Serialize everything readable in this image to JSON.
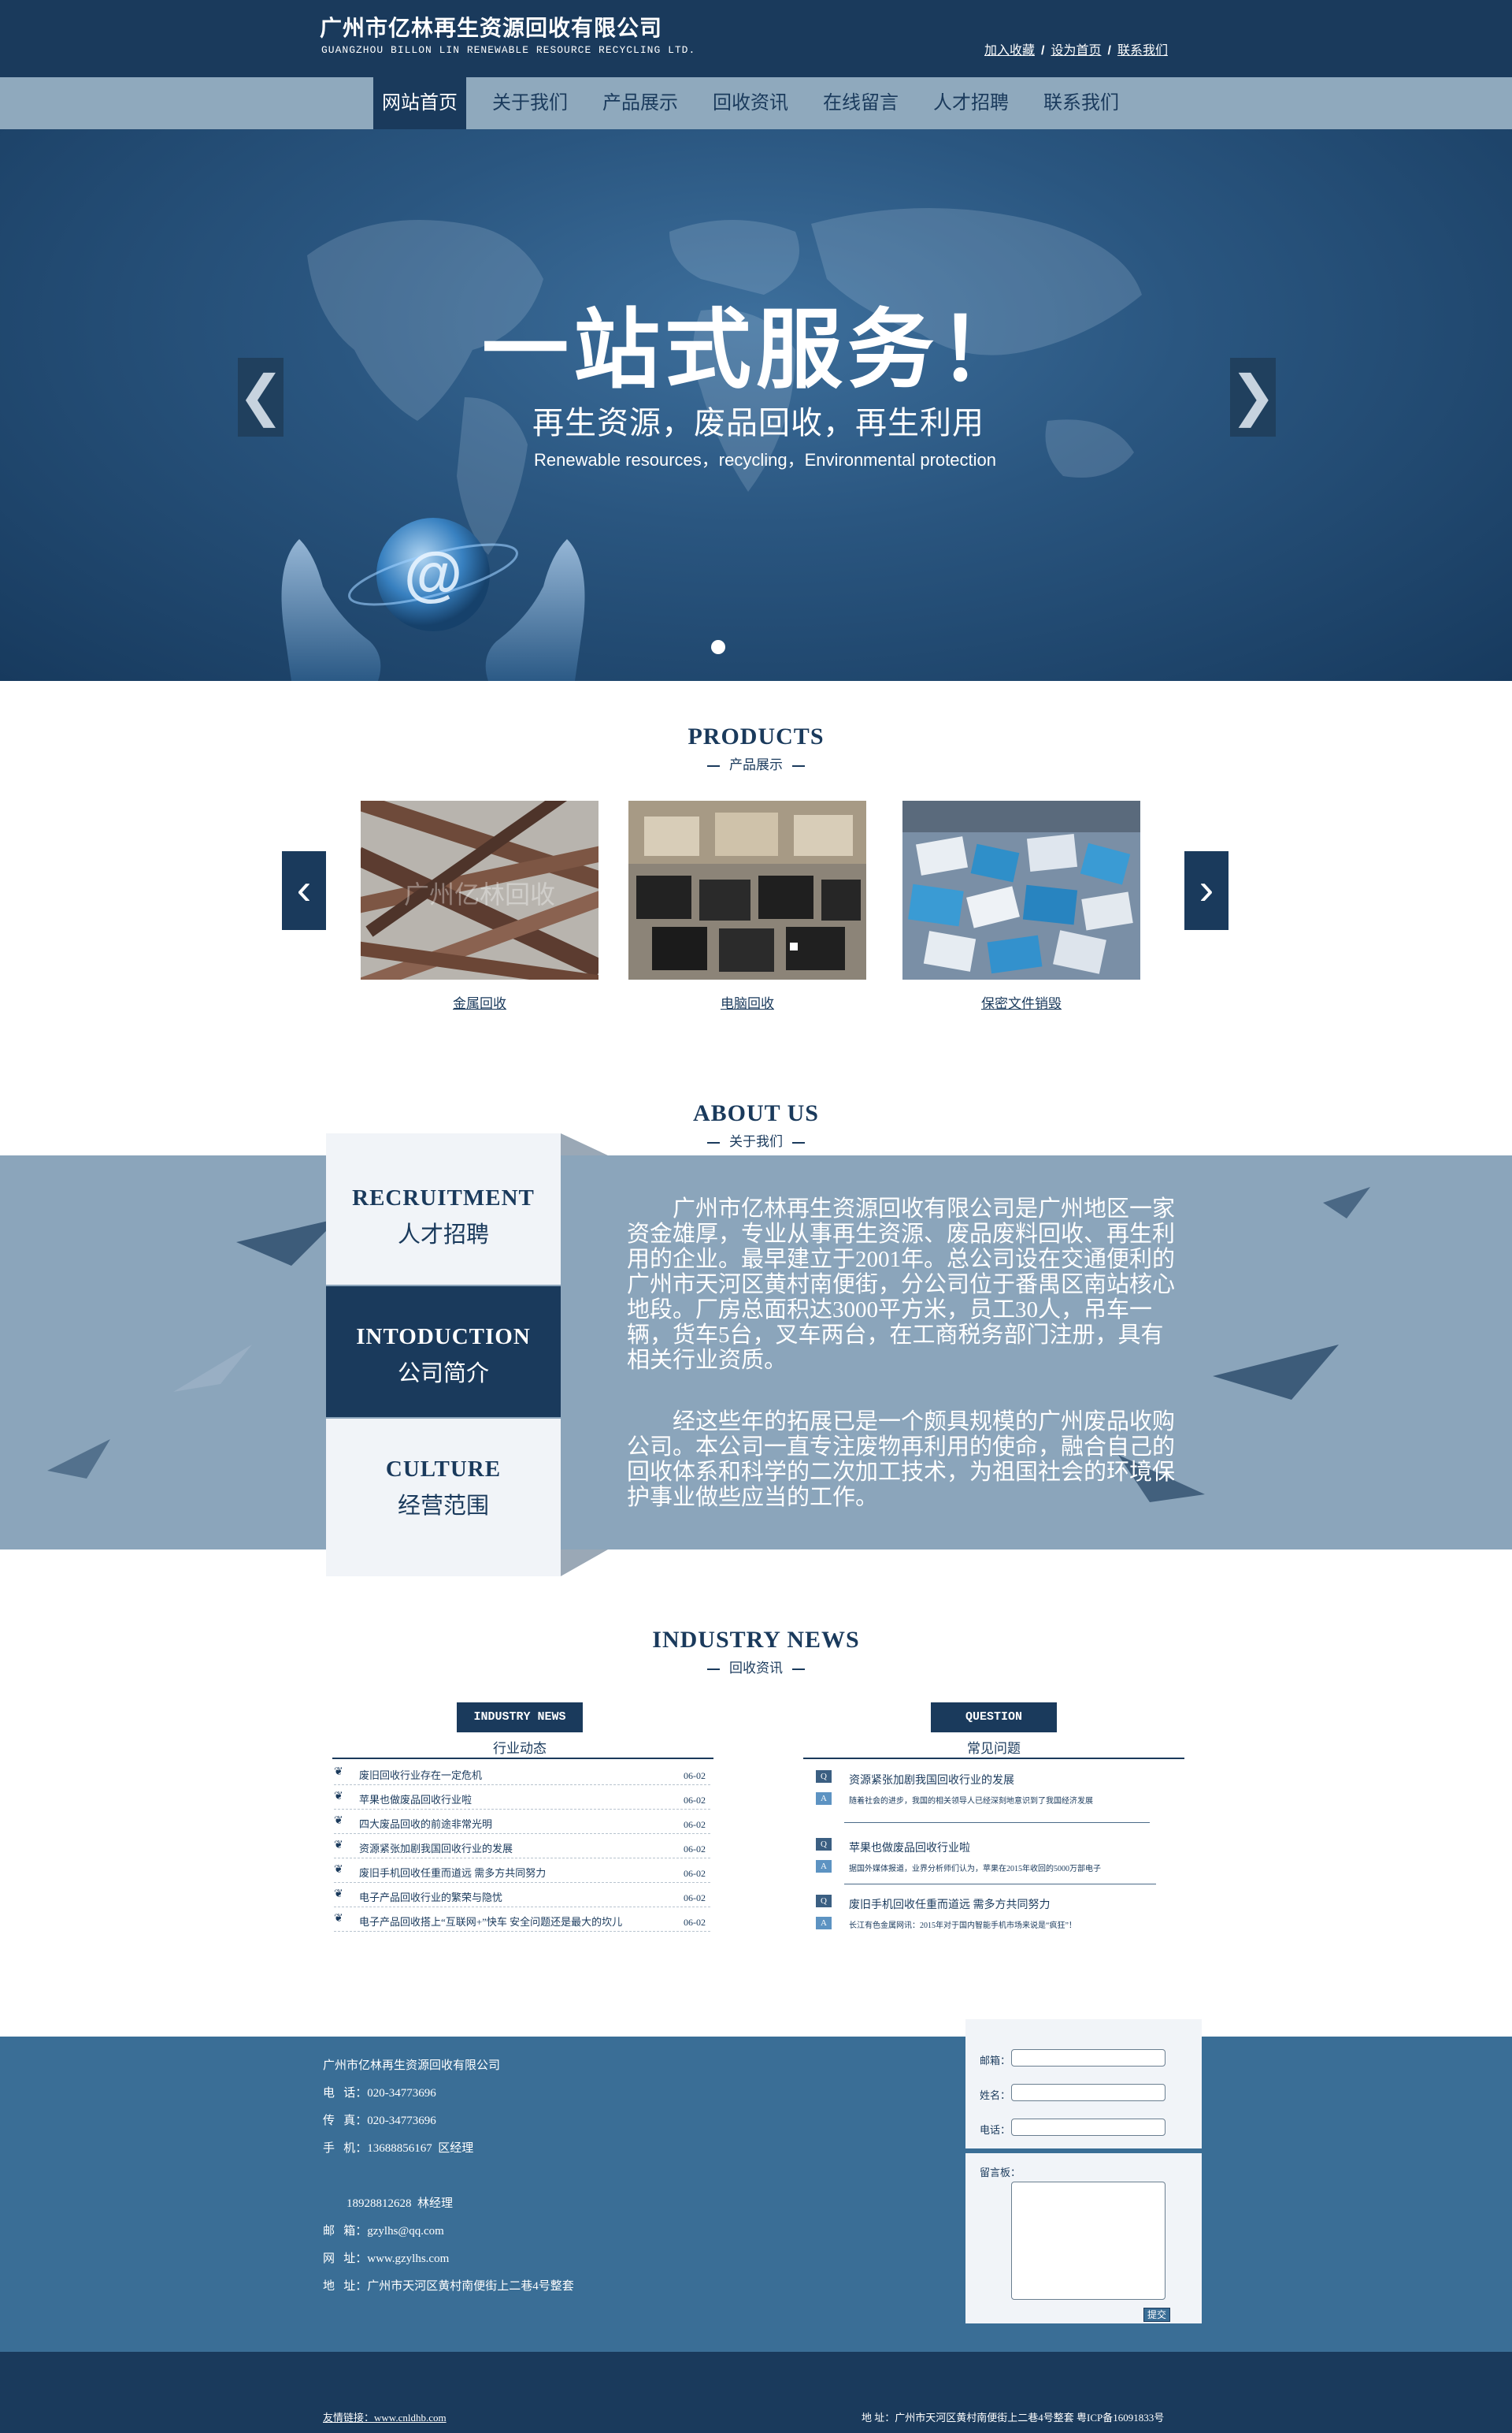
{
  "header": {
    "company_cn": "广州市亿林再生资源回收有限公司",
    "company_en": "GUANGZHOU BILLON LIN RENEWABLE RESOURCE RECYCLING LTD.",
    "links": [
      "加入收藏",
      "设为首页",
      "联系我们"
    ],
    "separator": "/"
  },
  "nav": {
    "items": [
      "网站首页",
      "关于我们",
      "产品展示",
      "回收资讯",
      "在线留言",
      "人才招聘",
      "联系我们"
    ],
    "active_index": 0
  },
  "banner": {
    "title": "一站式服务！",
    "subtitle": "再生资源，废品回收，再生利用",
    "subtitle_en": "Renewable resources，recycling，Environmental protection",
    "prev_arrow": "❮",
    "next_arrow": "❯",
    "slide_count": 1,
    "active_slide": 1
  },
  "products": {
    "title": "PRODUCTS",
    "subtitle": "产品展示",
    "prev_arrow": "‹",
    "next_arrow": "›",
    "watermark": "广州亿林回收",
    "items": [
      {
        "caption": "金属回收"
      },
      {
        "caption": "电脑回收"
      },
      {
        "caption": "保密文件销毁"
      }
    ]
  },
  "about": {
    "title": "ABOUT US",
    "subtitle": "关于我们",
    "tabs": [
      {
        "en": "RECRUITMENT",
        "cn": "人才招聘"
      },
      {
        "en": "INTODUCTION",
        "cn": "公司简介"
      },
      {
        "en": "CULTURE",
        "cn": "经营范围"
      }
    ],
    "active_tab": 1,
    "paragraphs": [
      "广州市亿林再生资源回收有限公司是广州地区一家资金雄厚，专业从事再生资源、废品废料回收、再生利用的企业。最早建立于2001年。总公司设在交通便利的广州市天河区黄村南便街，分公司位于番禺区南站核心地段。厂房总面积达3000平方米，员工30人，吊车一辆，货车5台，叉车两台，在工商税务部门注册，具有相关行业资质。",
      "经这些年的拓展已是一个颇具规模的广州废品收购公司。本公司一直专注废物再利用的使命，融合自己的回收体系和科学的二次加工技术，为祖国社会的环境保护事业做些应当的工作。"
    ]
  },
  "news": {
    "title": "INDUSTRY NEWS",
    "subtitle": "回收资讯",
    "industry": {
      "badge": "INDUSTRY NEWS",
      "sub": "行业动态",
      "items": [
        {
          "title": "废旧回收行业存在一定危机",
          "date": "06-02"
        },
        {
          "title": "苹果也做废品回收行业啦",
          "date": "06-02"
        },
        {
          "title": "四大废品回收的前途非常光明",
          "date": "06-02"
        },
        {
          "title": "资源紧张加剧我国回收行业的发展",
          "date": "06-02"
        },
        {
          "title": "废旧手机回收任重而道远  需多方共同努力",
          "date": "06-02"
        },
        {
          "title": "电子产品回收行业的繁荣与隐忧",
          "date": "06-02"
        },
        {
          "title": "电子产品回收搭上“互联网+”快车  安全问题还是最大的坎儿",
          "date": "06-02"
        }
      ]
    },
    "question": {
      "badge": "QUESTION",
      "sub": "常见问题",
      "q_icon": "Q",
      "a_icon": "A",
      "items": [
        {
          "q": "资源紧张加剧我国回收行业的发展",
          "a": "随着社会的进步，我国的相关领导人已经深刻地意识到了我国经济发展"
        },
        {
          "q": "苹果也做废品回收行业啦",
          "a": "据国外媒体报道，业界分析师们认为，苹果在2015年收回的5000万部电子"
        },
        {
          "q": "废旧手机回收任重而道远  需多方共同努力",
          "a": "长江有色金属网讯：2015年对于国内智能手机市场来说是“疯狂”！"
        }
      ]
    }
  },
  "footer": {
    "company": "广州市亿林再生资源回收有限公司",
    "lines": [
      "电   话：020-34773696",
      "传   真：020-34773696",
      "手   机：13688856167  区经理",
      "",
      "        18928812628  林经理",
      "邮   箱：gzylhs@qq.com",
      "网   址：www.gzylhs.com",
      "地   址：广州市天河区黄村南便街上二巷4号整套"
    ],
    "form": {
      "email_label": "邮箱：",
      "name_label": "姓名：",
      "phone_label": "电话：",
      "message_label": "留言板：",
      "submit_label": "提交"
    },
    "friend_label": "友情链接：",
    "friend_link": "www.cnldhb.com",
    "bottom_address": "地   址：广州市天河区黄村南便街上二巷4号整套   粤ICP备16091833号"
  }
}
